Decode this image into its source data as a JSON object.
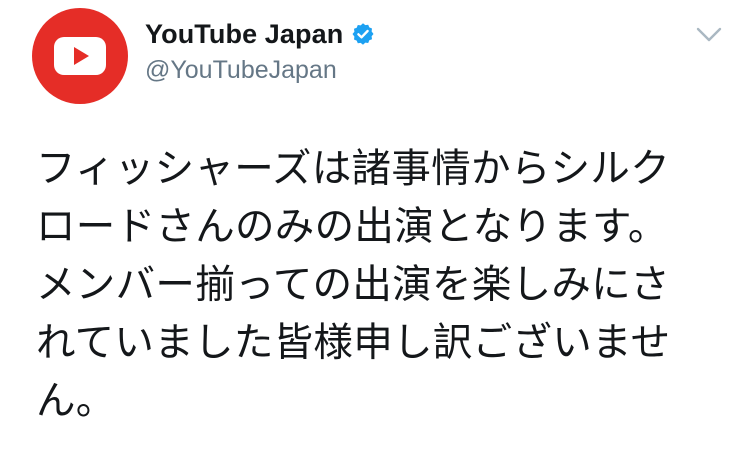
{
  "author": {
    "display_name": "YouTube Japan",
    "handle": "@YouTubeJapan",
    "verified": true,
    "avatar_icon": "youtube-play-logo-icon",
    "verified_icon": "verified-badge-icon"
  },
  "tweet": {
    "text_lines": [
      "フィッシャーズは諸事情からシルク",
      "ロードさんのみの出演となります。",
      "メンバー揃っての出演を楽しみにさ",
      "れていました皆様申し訳ございませ",
      "ん。"
    ]
  },
  "menu": {
    "icon": "chevron-down-icon"
  },
  "colors": {
    "avatar_bg": "#e52d27",
    "verified_blue": "#1da1f2",
    "text_primary": "#14171a",
    "text_secondary": "#657786",
    "caret_gray": "#aab8c2"
  }
}
